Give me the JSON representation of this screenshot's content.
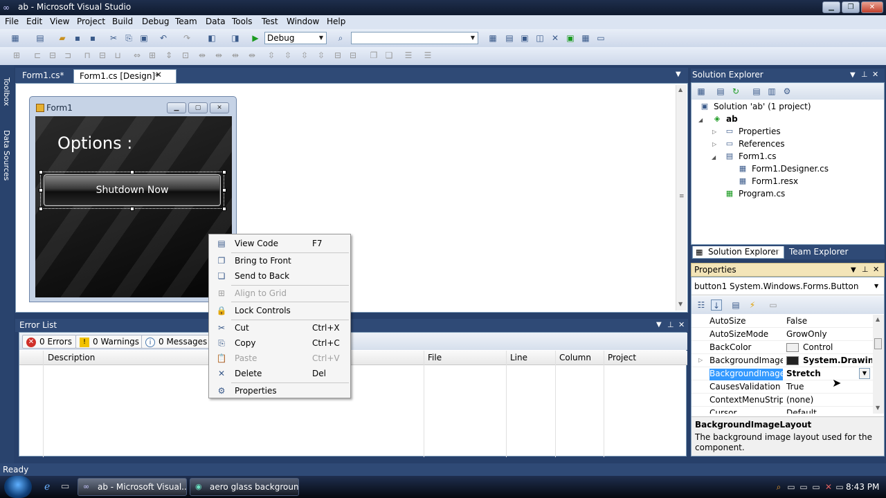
{
  "window": {
    "title": "ab - Microsoft Visual Studio"
  },
  "menu": [
    "File",
    "Edit",
    "View",
    "Project",
    "Build",
    "Debug",
    "Team",
    "Data",
    "Tools",
    "Test",
    "Window",
    "Help"
  ],
  "toolbar": {
    "config": "Debug",
    "platform": ""
  },
  "siderail": {
    "toolbox": "Toolbox",
    "datasources": "Data Sources"
  },
  "doctabs": [
    {
      "label": "Form1.cs*",
      "active": false
    },
    {
      "label": "Form1.cs [Design]*",
      "active": true
    }
  ],
  "form": {
    "caption": "Form1",
    "options_label": "Options :",
    "button_label": "Shutdown Now"
  },
  "context_menu": [
    {
      "icon": "code-icon",
      "glyph": "▤",
      "label": "View Code",
      "shortcut": "F7",
      "disabled": false
    },
    {
      "icon": "bring-front-icon",
      "glyph": "❐",
      "label": "Bring to Front",
      "shortcut": "",
      "disabled": false
    },
    {
      "icon": "send-back-icon",
      "glyph": "❏",
      "label": "Send to Back",
      "shortcut": "",
      "disabled": false
    },
    {
      "icon": "grid-icon",
      "glyph": "⊞",
      "label": "Align to Grid",
      "shortcut": "",
      "disabled": true
    },
    {
      "icon": "lock-icon",
      "glyph": "🔒",
      "label": "Lock Controls",
      "shortcut": "",
      "disabled": false
    },
    {
      "icon": "cut-icon",
      "glyph": "✂",
      "label": "Cut",
      "shortcut": "Ctrl+X",
      "disabled": false
    },
    {
      "icon": "copy-icon",
      "glyph": "⎘",
      "label": "Copy",
      "shortcut": "Ctrl+C",
      "disabled": false
    },
    {
      "icon": "paste-icon",
      "glyph": "📋",
      "label": "Paste",
      "shortcut": "Ctrl+V",
      "disabled": true
    },
    {
      "icon": "delete-icon",
      "glyph": "✕",
      "label": "Delete",
      "shortcut": "Del",
      "disabled": false
    },
    {
      "icon": "properties-icon",
      "glyph": "⚙",
      "label": "Properties",
      "shortcut": "",
      "disabled": false
    }
  ],
  "error_list": {
    "title": "Error List",
    "errors": "0 Errors",
    "warnings": "0 Warnings",
    "messages": "0 Messages",
    "columns": [
      "Description",
      "File",
      "Line",
      "Column",
      "Project"
    ]
  },
  "solution_explorer": {
    "title": "Solution Explorer",
    "tree": [
      {
        "label": "Solution 'ab' (1 project)",
        "icon": "solution-icon",
        "glyph": "▣",
        "bold": false
      },
      {
        "label": "ab",
        "icon": "project-icon",
        "glyph": "◈",
        "bold": true
      },
      {
        "label": "Properties",
        "icon": "folder-icon",
        "glyph": "▭",
        "bold": false
      },
      {
        "label": "References",
        "icon": "references-icon",
        "glyph": "▭",
        "bold": false
      },
      {
        "label": "Form1.cs",
        "icon": "form-file-icon",
        "glyph": "▤",
        "bold": false
      },
      {
        "label": "Form1.Designer.cs",
        "icon": "cs-file-icon",
        "glyph": "▦",
        "bold": false
      },
      {
        "label": "Form1.resx",
        "icon": "resx-file-icon",
        "glyph": "▦",
        "bold": false
      },
      {
        "label": "Program.cs",
        "icon": "cs-file-icon",
        "glyph": "▦",
        "bold": false
      }
    ],
    "tabs": [
      "Solution Explorer",
      "Team Explorer"
    ]
  },
  "properties": {
    "title": "Properties",
    "object_name": "button1",
    "object_type": "System.Windows.Forms.Button",
    "rows": [
      {
        "name": "AutoSize",
        "value": "False",
        "bold": false,
        "swatch": "",
        "selected": false
      },
      {
        "name": "AutoSizeMode",
        "value": "GrowOnly",
        "bold": false,
        "swatch": "",
        "selected": false
      },
      {
        "name": "BackColor",
        "value": "Control",
        "bold": false,
        "swatch": "#f0f0f0",
        "selected": false
      },
      {
        "name": "BackgroundImage",
        "value": "System.Drawing.",
        "bold": true,
        "swatch": "#222222",
        "selected": false
      },
      {
        "name": "BackgroundImageLayout",
        "value": "Stretch",
        "bold": true,
        "swatch": "",
        "selected": true
      },
      {
        "name": "CausesValidation",
        "value": "True",
        "bold": false,
        "swatch": "",
        "selected": false
      },
      {
        "name": "ContextMenuStrip",
        "value": "(none)",
        "bold": false,
        "swatch": "",
        "selected": false
      },
      {
        "name": "Cursor",
        "value": "Default",
        "bold": false,
        "swatch": "",
        "selected": false
      }
    ],
    "desc_title": "BackgroundImageLayout",
    "desc_text": "The background image layout used for the component."
  },
  "status": {
    "text": "Ready"
  },
  "taskbar": {
    "tasks": [
      "ab - Microsoft Visual...",
      "aero glass backgroun..."
    ],
    "clock": "8:43 PM"
  }
}
